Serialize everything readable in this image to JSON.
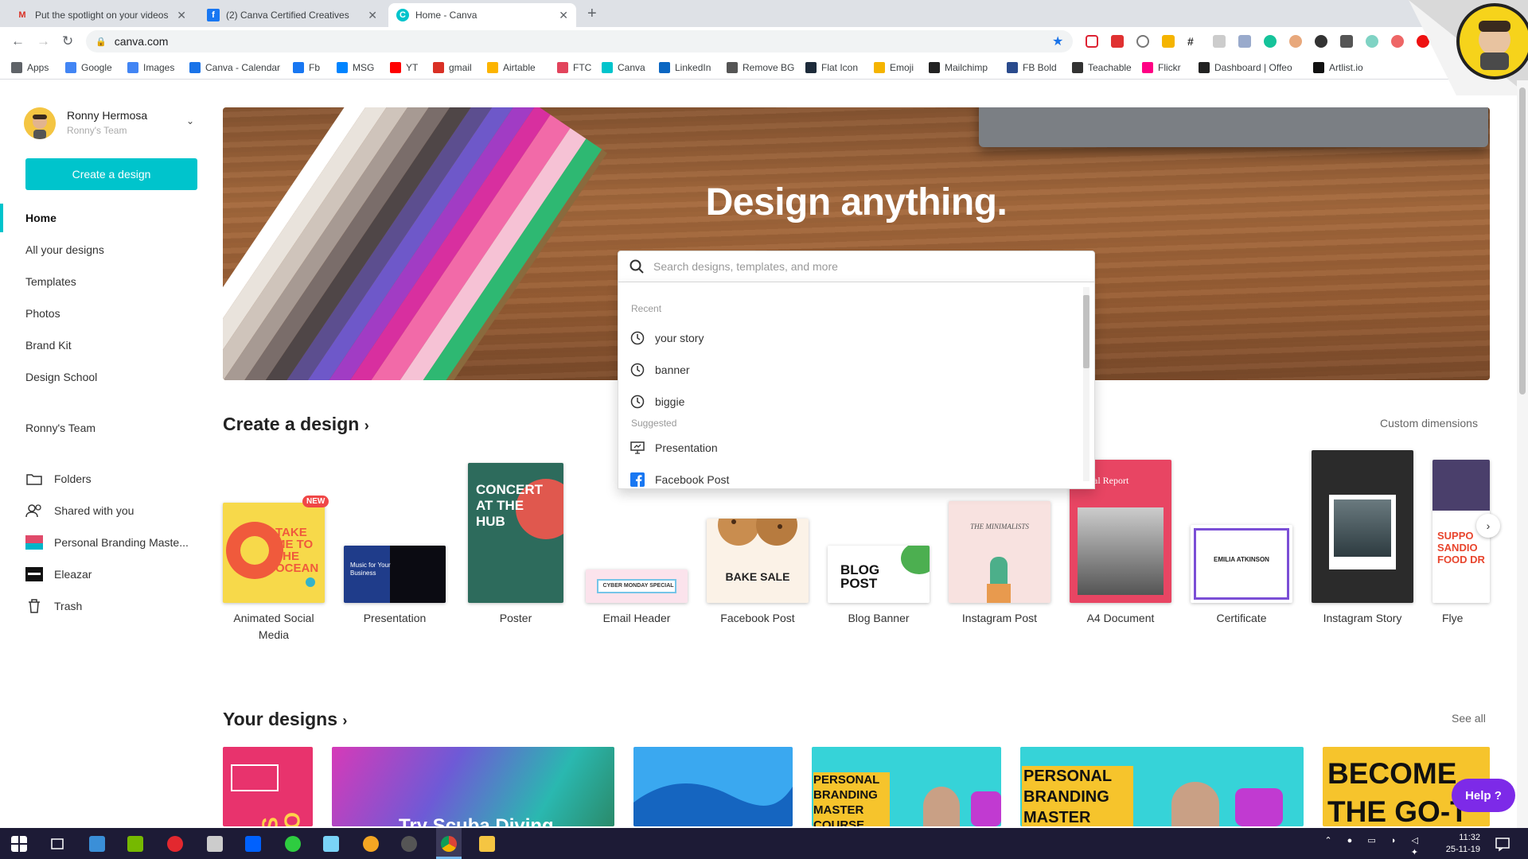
{
  "browser": {
    "tabs": [
      {
        "title": "Put the spotlight on your videos",
        "favicon": "gmail-icon",
        "active": false
      },
      {
        "title": "(2) Canva Certified Creatives",
        "favicon": "facebook-icon",
        "active": false
      },
      {
        "title": "Home - Canva",
        "favicon": "canva-icon",
        "active": true
      }
    ],
    "url": "canva.com",
    "bookmarks": [
      {
        "label": "Apps",
        "icon": "apps-grid-icon",
        "color": "#5f6368"
      },
      {
        "label": "Google",
        "icon": "google-icon",
        "color": "#4285f4"
      },
      {
        "label": "Images",
        "icon": "google-icon",
        "color": "#4285f4"
      },
      {
        "label": "Canva - Calendar",
        "icon": "calendar-icon",
        "color": "#1a73e8"
      },
      {
        "label": "Fb",
        "icon": "facebook-icon",
        "color": "#1877f2"
      },
      {
        "label": "MSG",
        "icon": "messenger-icon",
        "color": "#0084ff"
      },
      {
        "label": "YT",
        "icon": "youtube-icon",
        "color": "#ff0000"
      },
      {
        "label": "gmail",
        "icon": "gmail-icon",
        "color": "#d93025"
      },
      {
        "label": "Airtable",
        "icon": "airtable-icon",
        "color": "#fcb400"
      },
      {
        "label": "FTC",
        "icon": "ftc-icon",
        "color": "#e2445c"
      },
      {
        "label": "Canva",
        "icon": "canva-icon",
        "color": "#00c4cc"
      },
      {
        "label": "LinkedIn",
        "icon": "linkedin-icon",
        "color": "#0a66c2"
      },
      {
        "label": "Remove BG",
        "icon": "removebg-icon",
        "color": "#555555"
      },
      {
        "label": "Flat Icon",
        "icon": "flaticon-icon",
        "color": "#1d2b3a"
      },
      {
        "label": "Emoji",
        "icon": "emoji-icon",
        "color": "#f5b400"
      },
      {
        "label": "Mailchimp",
        "icon": "mailchimp-icon",
        "color": "#222222"
      },
      {
        "label": "FB Bold",
        "icon": "fbbold-icon",
        "color": "#2a4b8d"
      },
      {
        "label": "Teachable",
        "icon": "teachable-icon",
        "color": "#333333"
      },
      {
        "label": "Flickr",
        "icon": "flickr-icon",
        "color": "#ff0084"
      },
      {
        "label": "Dashboard | Offeo",
        "icon": "offeo-icon",
        "color": "#222222"
      },
      {
        "label": "Artlist.io",
        "icon": "artlist-icon",
        "color": "#111111"
      }
    ]
  },
  "sidebar": {
    "user_name": "Ronny Hermosa",
    "team_name": "Ronny's Team",
    "create_button": "Create a design",
    "nav": [
      {
        "label": "Home",
        "active": true
      },
      {
        "label": "All your designs"
      },
      {
        "label": "Templates"
      },
      {
        "label": "Photos"
      },
      {
        "label": "Brand Kit"
      },
      {
        "label": "Design School"
      }
    ],
    "team_link": "Ronny's Team",
    "folders": [
      {
        "label": "Folders",
        "icon": "folder-icon"
      },
      {
        "label": "Shared with you",
        "icon": "shared-users-icon"
      },
      {
        "label": "Personal Branding Maste...",
        "icon": "folder-thumb-icon"
      },
      {
        "label": "Eleazar",
        "icon": "folder-thumb-icon"
      },
      {
        "label": "Trash",
        "icon": "trash-icon"
      }
    ]
  },
  "hero": {
    "title": "Design anything.",
    "search_placeholder": "Search designs, templates, and more"
  },
  "search_dropdown": {
    "recent_label": "Recent",
    "recent": [
      "your story",
      "banner",
      "biggie"
    ],
    "suggested_label": "Suggested",
    "suggested": [
      {
        "label": "Presentation",
        "icon": "presentation-icon"
      },
      {
        "label": "Facebook Post",
        "icon": "facebook-icon"
      }
    ]
  },
  "create_section": {
    "title": "Create a design",
    "custom_link": "Custom dimensions",
    "new_badge": "NEW",
    "designs": [
      {
        "label": "Animated Social Media",
        "thumb_text": "TAKE ME TO THE OCEAN"
      },
      {
        "label": "Presentation",
        "thumb_text": "Music for Your Business"
      },
      {
        "label": "Poster",
        "thumb_text": "CONCERT AT THE HUB"
      },
      {
        "label": "Email Header",
        "thumb_text": "CYBER MONDAY SPECIAL"
      },
      {
        "label": "Facebook Post",
        "thumb_text": "BAKE SALE"
      },
      {
        "label": "Blog Banner",
        "thumb_text": "BLOG POST"
      },
      {
        "label": "Instagram Post",
        "thumb_text": "THE MINIMALISTS"
      },
      {
        "label": "A4 Document",
        "thumb_text": "ual Report"
      },
      {
        "label": "Certificate",
        "thumb_text": "EMILIA ATKINSON"
      },
      {
        "label": "Instagram Story",
        "thumb_text": ""
      },
      {
        "label": "Flye",
        "thumb_text": "SUPPO SANDIO FOOD DR"
      }
    ]
  },
  "your_designs": {
    "title": "Your designs",
    "see_all": "See all",
    "thumbs": [
      {
        "text": "YS GO"
      },
      {
        "text": "Try Scuba Diving"
      },
      {
        "text": ""
      },
      {
        "text": "PERSONAL BRANDING MASTER COURSE"
      },
      {
        "text": "PERSONAL BRANDING MASTER"
      },
      {
        "text": "BECOME THE GO-T"
      }
    ]
  },
  "help_button": "Help ?",
  "taskbar": {
    "time": "11:32",
    "date": "25-11-19"
  },
  "colors": {
    "accent": "#00c4cc",
    "help": "#7d2ae8",
    "taskbar": "#1d1b36"
  }
}
